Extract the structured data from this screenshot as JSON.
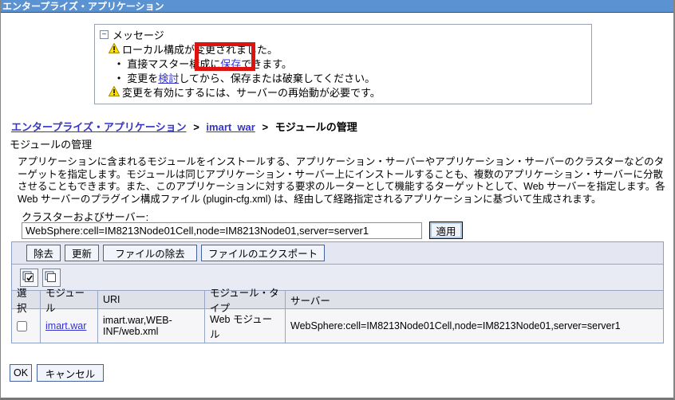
{
  "window": {
    "title": "エンタープライズ・アプリケーション"
  },
  "icons": {
    "collapse_glyph": "−",
    "bullet_glyph": "•"
  },
  "messages": {
    "header": "メッセージ",
    "warning1": "ローカル構成が変更されました。",
    "bullet1_pre": "直接マスター構成に",
    "bullet1_link": "保存",
    "bullet1_post": "できます。",
    "bullet2_pre": "変更を",
    "bullet2_link": "検討",
    "bullet2_post": "してから、保存または破棄してください。",
    "warning2": "変更を有効にするには、サーバーの再始動が必要です。"
  },
  "breadcrumb": {
    "link1": "エンタープライズ・アプリケーション",
    "sep": ">",
    "link2": "imart_war",
    "current": "モジュールの管理"
  },
  "page": {
    "subtitle": "モジュールの管理",
    "description": "アプリケーションに含まれるモジュールをインストールする、アプリケーション・サーバーやアプリケーション・サーバーのクラスターなどのターゲットを指定します。モジュールは同じアプリケーション・サーバー上にインストールすることも、複数のアプリケーション・サーバーに分散させることもできます。また、このアプリケーションに対する要求のルーターとして機能するターゲットとして、Web サーバーを指定します。各 Web サーバーのプラグイン構成ファイル (plugin-cfg.xml) は、経由して経路指定されるアプリケーションに基づいて生成されます。"
  },
  "cluster_server": {
    "label": "クラスターおよびサーバー:",
    "value": "WebSphere:cell=IM8213Node01Cell,node=IM8213Node01,server=server1",
    "apply_label": "適用"
  },
  "toolbar": {
    "remove_label": "除去",
    "update_label": "更新",
    "remove_file_label": "ファイルの除去",
    "export_file_label": "ファイルのエクスポート"
  },
  "table": {
    "headers": [
      "選択",
      "モジュール",
      "URI",
      "モジュール・タイプ",
      "サーバー"
    ],
    "rows": [
      {
        "module": "imart.war",
        "uri": "imart.war,WEB-INF/web.xml",
        "module_type": "Web モジュール",
        "server": "WebSphere:cell=IM8213Node01Cell,node=IM8213Node01,server=server1"
      }
    ]
  },
  "footer": {
    "ok_label": "OK",
    "cancel_label": "キャンセル"
  },
  "colors": {
    "titlebar": "#5b92d2",
    "link": "#3333cc",
    "annotation": "#dd1310"
  }
}
